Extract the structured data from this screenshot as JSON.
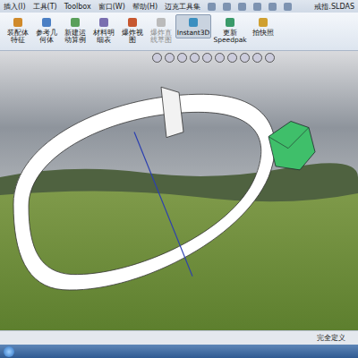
{
  "menu": [
    "插入(I)",
    "工具(T)",
    "Toolbox",
    "窗口(W)",
    "帮助(H)",
    "迈克工具集"
  ],
  "document_title": "戒指.SLDAS",
  "commands": [
    {
      "label": "装配体特征",
      "selected": false,
      "disabled": false
    },
    {
      "label": "参考几何体",
      "selected": false,
      "disabled": false
    },
    {
      "label": "新建运动算例",
      "selected": false,
      "disabled": false
    },
    {
      "label": "材料明细表",
      "selected": false,
      "disabled": false
    },
    {
      "label": "爆炸视图",
      "selected": false,
      "disabled": false
    },
    {
      "label": "爆炸直线草图",
      "selected": false,
      "disabled": true
    },
    {
      "label": "Instant3D",
      "selected": true,
      "disabled": false
    },
    {
      "label": "更新Speedpak",
      "selected": false,
      "disabled": false
    },
    {
      "label": "拍快照",
      "selected": false,
      "disabled": false
    }
  ],
  "status_bar": {
    "text": "完全定义"
  }
}
